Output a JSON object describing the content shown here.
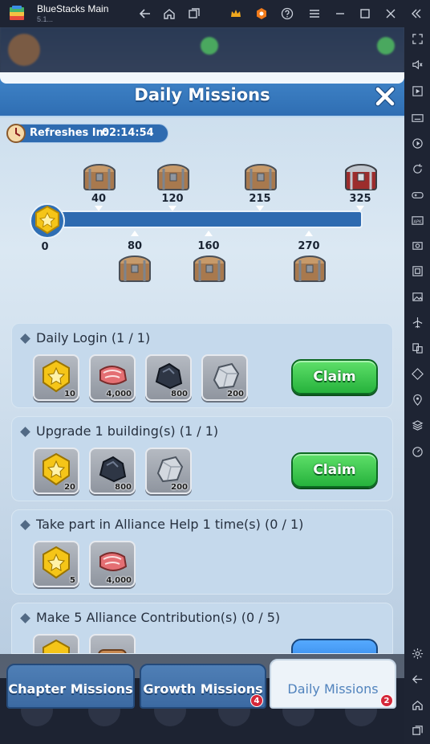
{
  "window": {
    "title": "BlueStacks Main",
    "subtitle": "5.1..."
  },
  "panel": {
    "title": "Daily Missions",
    "refresh_label": "Refreshes In:",
    "refresh_time": "02:14:54"
  },
  "progress": {
    "current": "0",
    "value": 0,
    "max": 325,
    "milestones_top": [
      "40",
      "120",
      "215",
      "325"
    ],
    "milestones_bottom": [
      "80",
      "160",
      "270"
    ]
  },
  "missions": [
    {
      "title": "Daily Login (1 / 1)",
      "rewards": [
        {
          "icon": "medal-icon",
          "qty": "10"
        },
        {
          "icon": "meat-icon",
          "qty": "4,000"
        },
        {
          "icon": "ore-icon",
          "qty": "800"
        },
        {
          "icon": "stone-icon",
          "qty": "200"
        }
      ],
      "button": "Claim"
    },
    {
      "title": "Upgrade 1 building(s) (1 / 1)",
      "rewards": [
        {
          "icon": "medal-icon",
          "qty": "20"
        },
        {
          "icon": "ore-icon",
          "qty": "800"
        },
        {
          "icon": "stone-icon",
          "qty": "200"
        }
      ],
      "button": "Claim"
    },
    {
      "title": "Take part in Alliance Help 1 time(s) (0 / 1)",
      "rewards": [
        {
          "icon": "medal-icon",
          "qty": "5"
        },
        {
          "icon": "meat-icon",
          "qty": "4,000"
        }
      ]
    },
    {
      "title": "Make 5 Alliance Contribution(s) (0 / 5)",
      "rewards": [
        {
          "icon": "medal-icon",
          "qty": ""
        },
        {
          "icon": "wood-icon",
          "qty": ""
        }
      ]
    }
  ],
  "tabs": [
    {
      "label": "Chapter Missions",
      "badge": ""
    },
    {
      "label": "Growth Missions",
      "badge": "4"
    },
    {
      "label": "Daily Missions",
      "badge": "2"
    }
  ],
  "colors": {
    "header": "#3f83c7",
    "claim_green": "#26b23c",
    "badge_red": "#d5283a"
  }
}
